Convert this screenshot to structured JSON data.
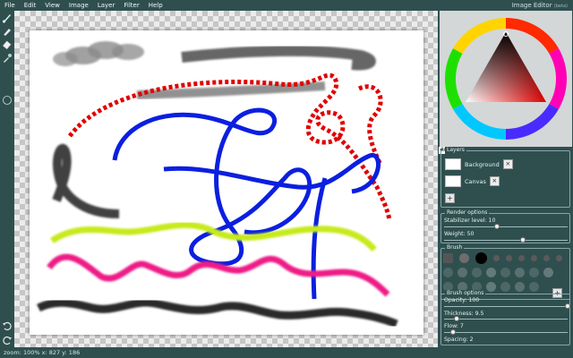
{
  "menu": [
    "File",
    "Edit",
    "View",
    "Image",
    "Layer",
    "Filter",
    "Help"
  ],
  "app": {
    "title": "Image Editor",
    "badge": "(beta)"
  },
  "tools": [
    {
      "name": "brush-tool-icon"
    },
    {
      "name": "pencil-tool-icon"
    },
    {
      "name": "eraser-tool-icon"
    },
    {
      "name": "eyedropper-tool-icon"
    }
  ],
  "bottom_tools": [
    {
      "name": "undo-icon"
    },
    {
      "name": "redo-icon"
    }
  ],
  "color": {
    "hex": "#000000"
  },
  "layers": {
    "title": "Layers",
    "items": [
      {
        "label": "Background"
      },
      {
        "label": "Canvas",
        "active": true
      }
    ]
  },
  "render_options": {
    "title": "Render options",
    "stabilizer_label": "Stabilizer level: 10",
    "stabilizer_value": 0.43,
    "weight_label": "Weight: 50",
    "weight_value": 0.64
  },
  "brush": {
    "title": "Brush"
  },
  "brush_options": {
    "title": "Brush options",
    "opacity_label": "Opacity: 100",
    "opacity_value": 1.0,
    "thickness_label": "Thickness: 9.5",
    "thickness_value": 0.1,
    "flow_label": "Flow: 7",
    "flow_value": 0.07,
    "spacing_label": "Spacing: 2"
  },
  "status": {
    "text": "zoom: 100% x: 827 y: 186"
  }
}
